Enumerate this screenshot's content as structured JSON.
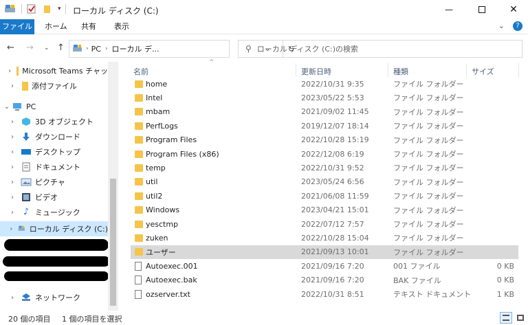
{
  "title": "ローカル ディスク (C:)",
  "ribbon": {
    "tabs": [
      "ファイル",
      "ホーム",
      "共有",
      "表示"
    ]
  },
  "address": {
    "crumbs": [
      "PC",
      "ローカル デ..."
    ],
    "search_placeholder": "ローカル ディスク (C:)の検索"
  },
  "nav": {
    "items": [
      {
        "label": "Microsoft Teams チャッ",
        "icon": "folder-icon"
      },
      {
        "label": "添付ファイル",
        "icon": "folder-icon"
      },
      {
        "label": "PC",
        "icon": "pc-icon"
      },
      {
        "label": "3D オブジェクト",
        "icon": "3d-objects-icon"
      },
      {
        "label": "ダウンロード",
        "icon": "download-icon"
      },
      {
        "label": "デスクトップ",
        "icon": "desktop-icon"
      },
      {
        "label": "ドキュメント",
        "icon": "documents-icon"
      },
      {
        "label": "ピクチャ",
        "icon": "pictures-icon"
      },
      {
        "label": "ビデオ",
        "icon": "video-icon"
      },
      {
        "label": "ミュージック",
        "icon": "music-icon"
      },
      {
        "label": "ローカル ディスク (C:)",
        "icon": "drive-icon"
      },
      {
        "label": "ネットワーク",
        "icon": "network-icon"
      }
    ]
  },
  "columns": {
    "name": "名前",
    "date": "更新日時",
    "type": "種類",
    "size": "サイズ"
  },
  "files": [
    {
      "name": "home",
      "date": "2022/10/31 9:35",
      "type": "ファイル フォルダー",
      "size": "",
      "kind": "folder"
    },
    {
      "name": "Intel",
      "date": "2023/05/22 5:53",
      "type": "ファイル フォルダー",
      "size": "",
      "kind": "folder"
    },
    {
      "name": "mbam",
      "date": "2021/09/02 11:45",
      "type": "ファイル フォルダー",
      "size": "",
      "kind": "folder"
    },
    {
      "name": "PerfLogs",
      "date": "2019/12/07 18:14",
      "type": "ファイル フォルダー",
      "size": "",
      "kind": "folder"
    },
    {
      "name": "Program Files",
      "date": "2022/10/28 15:19",
      "type": "ファイル フォルダー",
      "size": "",
      "kind": "folder"
    },
    {
      "name": "Program Files (x86)",
      "date": "2022/12/08 6:19",
      "type": "ファイル フォルダー",
      "size": "",
      "kind": "folder"
    },
    {
      "name": "temp",
      "date": "2022/10/31 9:52",
      "type": "ファイル フォルダー",
      "size": "",
      "kind": "folder"
    },
    {
      "name": "util",
      "date": "2023/05/24 6:56",
      "type": "ファイル フォルダー",
      "size": "",
      "kind": "folder"
    },
    {
      "name": "util2",
      "date": "2021/06/08 11:59",
      "type": "ファイル フォルダー",
      "size": "",
      "kind": "folder"
    },
    {
      "name": "Windows",
      "date": "2023/04/21 15:01",
      "type": "ファイル フォルダー",
      "size": "",
      "kind": "folder"
    },
    {
      "name": "yesctmp",
      "date": "2022/07/12 7:57",
      "type": "ファイル フォルダー",
      "size": "",
      "kind": "folder"
    },
    {
      "name": "zuken",
      "date": "2022/10/28 15:04",
      "type": "ファイル フォルダー",
      "size": "",
      "kind": "folder"
    },
    {
      "name": "ユーザー",
      "date": "2021/09/13 10:01",
      "type": "ファイル フォルダー",
      "size": "",
      "kind": "folder",
      "selected": true
    },
    {
      "name": "Autoexec.001",
      "date": "2021/09/16 7:20",
      "type": "001 ファイル",
      "size": "0 KB",
      "kind": "file"
    },
    {
      "name": "Autoexec.bak",
      "date": "2021/09/16 7:20",
      "type": "BAK ファイル",
      "size": "0 KB",
      "kind": "file"
    },
    {
      "name": "ozserver.txt",
      "date": "2022/10/31 8:51",
      "type": "テキスト ドキュメント",
      "size": "1 KB",
      "kind": "file"
    }
  ],
  "status": {
    "count": "20 個の項目",
    "selection": "1 個の項目を選択"
  },
  "colors": {
    "accent": "#1979ca",
    "selected_row": "#d9d9d9",
    "selected_nav": "#cce8ff",
    "folder": "#f5c44b"
  }
}
